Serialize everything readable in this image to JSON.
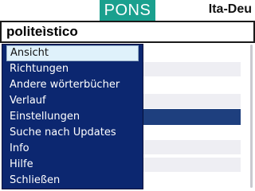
{
  "header": {
    "logo_text": "PONS",
    "direction": "Ita-Deu"
  },
  "search": {
    "value": "politeìstico"
  },
  "menu": {
    "items": [
      {
        "label": "Ansicht",
        "active": true
      },
      {
        "label": "Richtungen"
      },
      {
        "label": "Andere wörterbücher"
      },
      {
        "label": "Verlauf"
      },
      {
        "label": "Einstellungen"
      },
      {
        "label": "Suche nach Updates"
      },
      {
        "label": "Info"
      },
      {
        "label": "Hilfe"
      },
      {
        "label": "Schließen"
      }
    ]
  },
  "colors": {
    "logo_bg": "#1aa08e",
    "menu_bg": "#0c2770",
    "selected_row": "#1e3f7e",
    "highlight_item": "#dff1fb"
  }
}
